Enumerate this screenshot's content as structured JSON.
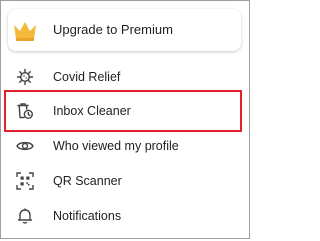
{
  "premium": {
    "label": "Upgrade to Premium",
    "icon": "crown-icon",
    "accent": "#f4b83a"
  },
  "menu": {
    "items": [
      {
        "label": "Covid Relief",
        "icon": "virus-icon"
      },
      {
        "label": "Inbox Cleaner",
        "icon": "trash-clock-icon"
      },
      {
        "label": "Who viewed my profile",
        "icon": "eye-icon"
      },
      {
        "label": "QR Scanner",
        "icon": "qr-scan-icon"
      },
      {
        "label": "Notifications",
        "icon": "bell-icon"
      }
    ]
  },
  "highlight_color": "#e0232b"
}
